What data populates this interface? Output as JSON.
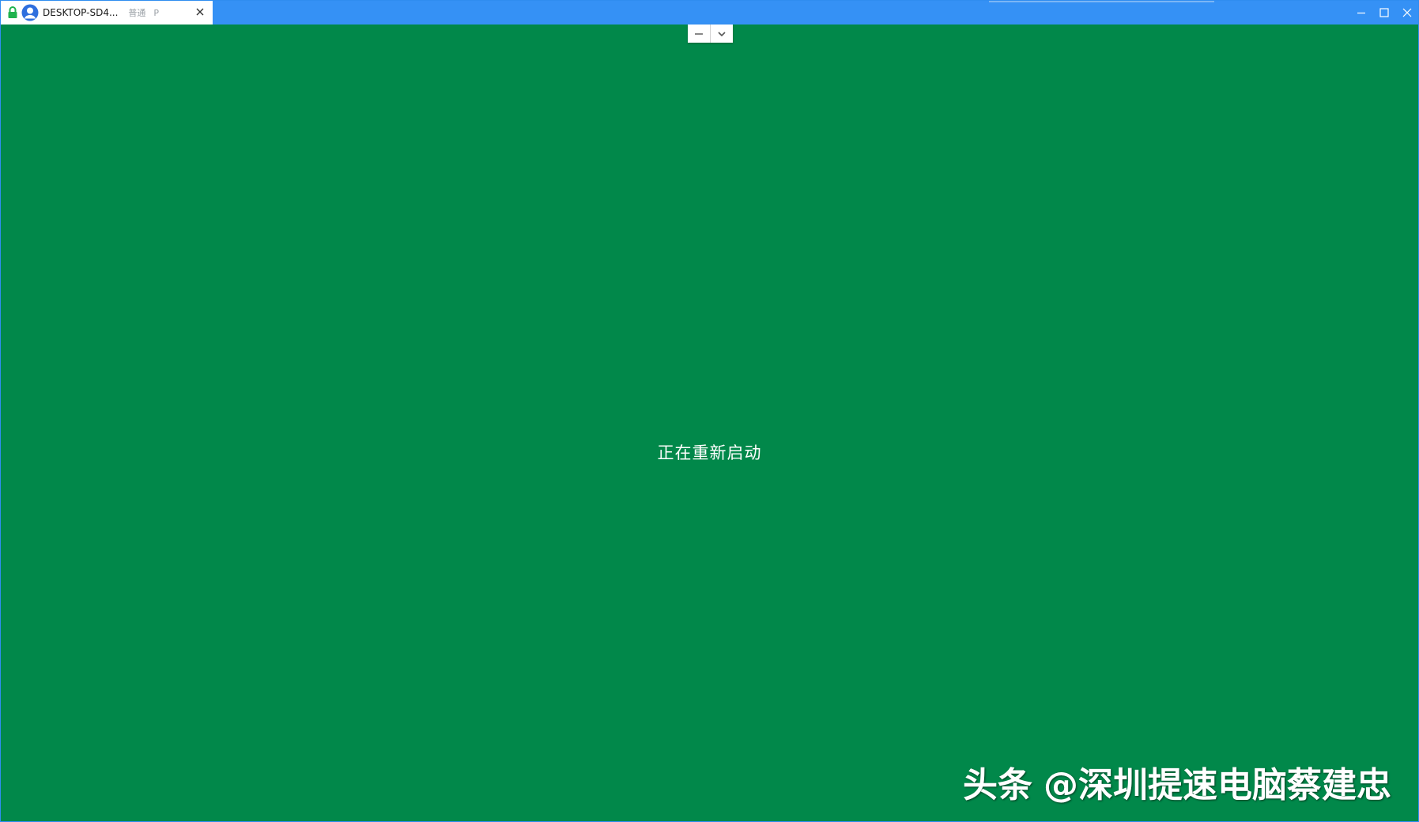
{
  "window": {
    "background_color": "#01884a",
    "titlebar_color": "#3591f5"
  },
  "tab": {
    "title": "DESKTOP-SD4...",
    "mode": "普通",
    "letter": "P",
    "icons": {
      "lock": "lock-icon",
      "avatar": "avatar-icon",
      "close": "close-icon"
    }
  },
  "window_controls": {
    "icons": [
      "minimize-icon",
      "maximize-icon",
      "close-icon"
    ]
  },
  "connection_bar": {
    "icons": [
      "minimize-icon",
      "chevron-down-icon"
    ]
  },
  "status": {
    "message": "正在重新启动"
  },
  "watermark": {
    "brand": "头条",
    "handle": "@深圳提速电脑蔡建忠"
  }
}
